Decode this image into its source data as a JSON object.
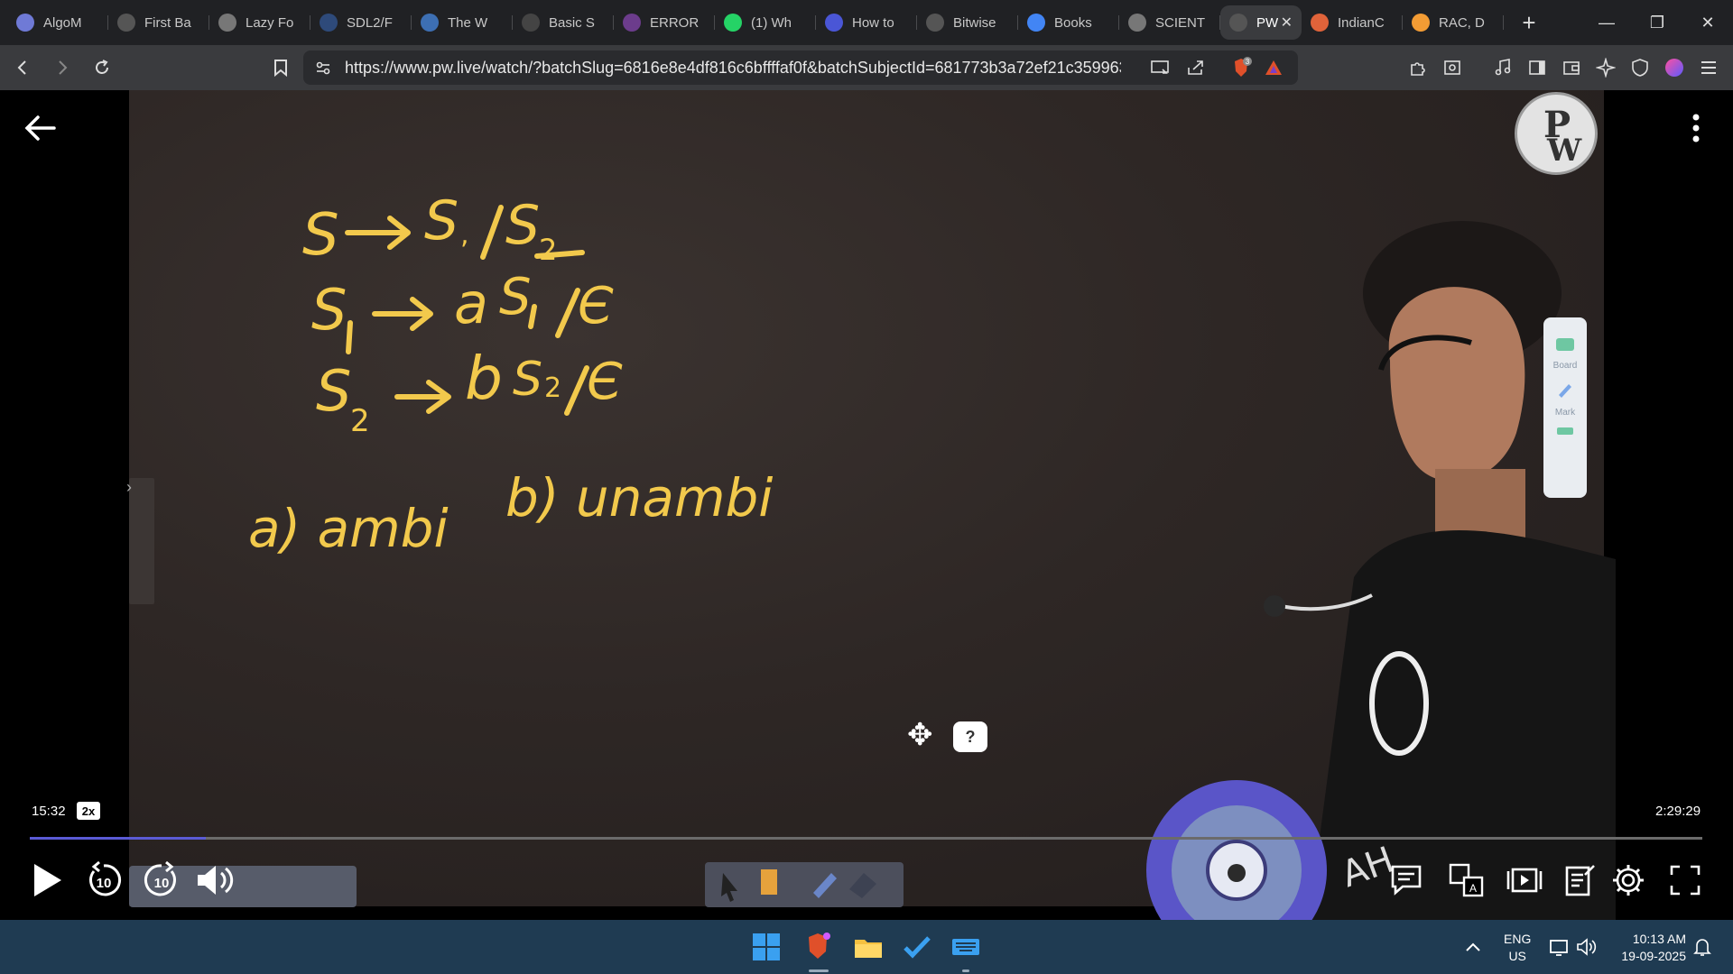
{
  "browser": {
    "tabs": [
      {
        "label": "AlgoM",
        "icon": "algomaster-favicon",
        "color": "#6f7ad6"
      },
      {
        "label": "First Ba",
        "icon": "circle-favicon",
        "color": "#555"
      },
      {
        "label": "Lazy Fo",
        "icon": "globe-favicon",
        "color": "#777"
      },
      {
        "label": "SDL2/F",
        "icon": "sdl-favicon",
        "color": "#2e4a7a"
      },
      {
        "label": "The W",
        "icon": "wordpress-favicon",
        "color": "#3d6fb3"
      },
      {
        "label": "Basic S",
        "icon": "code-favicon",
        "color": "#444"
      },
      {
        "label": "ERROR",
        "icon": "error-favicon",
        "color": "#6c3c8c"
      },
      {
        "label": "(1) Wh",
        "icon": "whatsapp-favicon",
        "color": "#25d366"
      },
      {
        "label": "How to",
        "icon": "bookmark-favicon",
        "color": "#4a56d6"
      },
      {
        "label": "Bitwise",
        "icon": "orig-favicon",
        "color": "#555"
      },
      {
        "label": "Books",
        "icon": "google-favicon",
        "color": "#4285f4"
      },
      {
        "label": "SCIENT",
        "icon": "globe-favicon",
        "color": "#777"
      },
      {
        "label": "PW",
        "icon": "pw-favicon",
        "color": "#555",
        "active": true
      },
      {
        "label": "IndianC",
        "icon": "indian-favicon",
        "color": "#e0633a"
      },
      {
        "label": "RAC, D",
        "icon": "india-flag-favicon",
        "color": "#f39c34"
      }
    ],
    "url": "https://www.pw.live/watch/?batchSlug=6816e8e4df816c6bffffaf0f&batchSubjectId=681773b3a72ef21c3599634...",
    "brave_badge": "3"
  },
  "player": {
    "current_time": "15:32",
    "speed": "2x",
    "total_time": "2:29:29",
    "progress_fraction": 0.105,
    "buffered_fraction": 0.105,
    "rewind_seconds": "10",
    "forward_seconds": "10",
    "side_panel": {
      "board_label": "Board",
      "mark_label": "Mark"
    },
    "logo_text": "PW"
  },
  "whiteboard": {
    "lines": [
      "S → S1 / S2",
      "S1 → a S1 / ε",
      "S2 → b S2 / ε"
    ],
    "options": [
      "a) ambi",
      "b) unambi"
    ]
  },
  "taskbar": {
    "lang_line1": "ENG",
    "lang_line2": "US",
    "time": "10:13 AM",
    "date": "19-09-2025"
  }
}
